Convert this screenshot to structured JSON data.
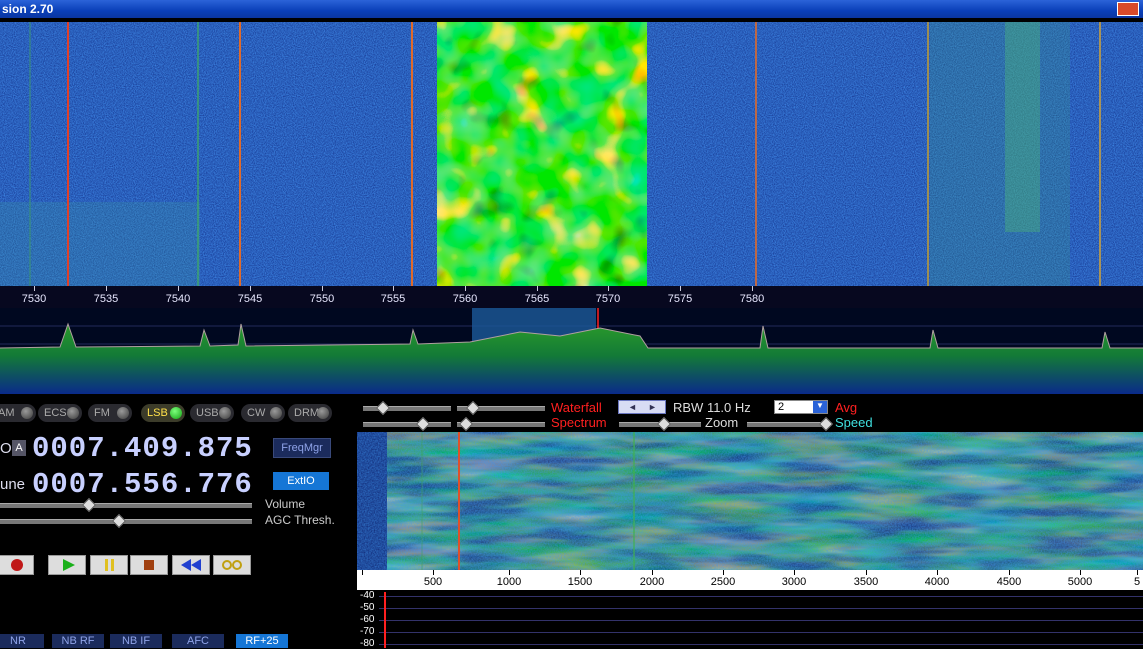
{
  "window": {
    "title": "sion 2.70"
  },
  "main_axis": {
    "labels": [
      "7530",
      "7535",
      "7540",
      "7545",
      "7550",
      "7555",
      "7560",
      "7565",
      "7570",
      "7575",
      "7580"
    ]
  },
  "modes": [
    {
      "label": "AM",
      "active": false
    },
    {
      "label": "ECSS",
      "active": false
    },
    {
      "label": "FM",
      "active": false
    },
    {
      "label": "LSB",
      "active": true
    },
    {
      "label": "USB",
      "active": false
    },
    {
      "label": "CW",
      "active": false
    },
    {
      "label": "DRM",
      "active": false
    }
  ],
  "lo": {
    "label": "O",
    "badge": "A",
    "value": "0007.409.875"
  },
  "tune": {
    "label": "une",
    "value": "0007.556.776"
  },
  "buttons": {
    "freqmgr": "FreqMgr",
    "extio": "ExtIO"
  },
  "sliders": {
    "volume_label": "Volume",
    "agc_label": "AGC Thresh.",
    "volume_level": 0.35,
    "agc_level": 0.47
  },
  "bottom_buttons": [
    {
      "label": "NR",
      "on": false
    },
    {
      "label": "NB RF",
      "on": false
    },
    {
      "label": "NB IF",
      "on": false
    },
    {
      "label": "AFC",
      "on": false
    },
    {
      "label": "RF+25",
      "on": true
    }
  ],
  "right_toolbar": {
    "waterfall_label": "Waterfall",
    "spectrum_label": "Spectrum",
    "rbw_label": "RBW 11.0 Hz",
    "avg_value": "2",
    "avg_label": "Avg",
    "zoom_label": "Zoom",
    "speed_label": "Speed"
  },
  "audio_axis": {
    "labels": [
      "500",
      "1000",
      "1500",
      "2000",
      "2500",
      "3000",
      "3500",
      "4000",
      "4500",
      "5000",
      "5"
    ]
  },
  "audio_spectrum": {
    "db_labels": [
      "-40",
      "-50",
      "-60",
      "-70",
      "-80"
    ]
  },
  "colors": {
    "accent_red": "#ff2020",
    "accent_cyan": "#40e0e0",
    "button_blue": "#1576d6",
    "led_green": "#12a012"
  }
}
